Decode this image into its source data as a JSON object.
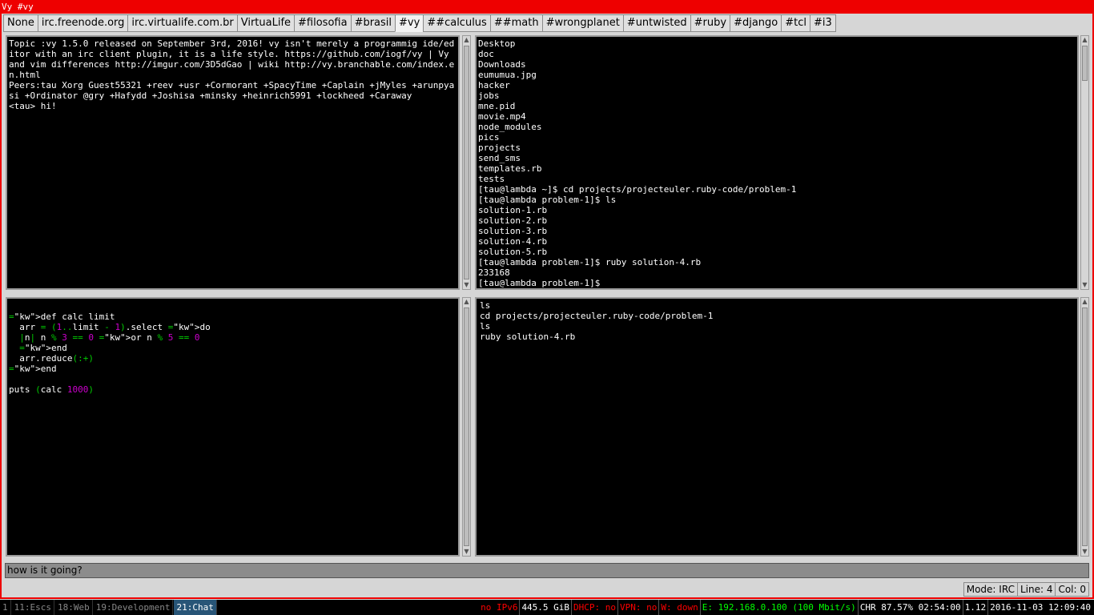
{
  "window": {
    "title": "Vy #vy"
  },
  "tabs": [
    "None",
    "irc.freenode.org",
    "irc.virtualife.com.br",
    "VirtuaLife",
    "#filosofia",
    "#brasil",
    "#vy",
    "##calculus",
    "##math",
    "#wrongplanet",
    "#untwisted",
    "#ruby",
    "#django",
    "#tcl",
    "#i3"
  ],
  "active_tab": "#vy",
  "chat_pane": {
    "text": "Topic :vy 1.5.0 released on September 3rd, 2016! vy isn't merely a programmig ide/editor with an irc client plugin, it is a life style. https://github.com/iogf/vy | Vy and vim differences http://imgur.com/3D5dGao | wiki http://vy.branchable.com/index.en.html\nPeers:tau Xorg Guest55321 +reev +usr +Cormorant +SpacyTime +Caplain +jMyles +arunpyasi +Ordinator @gry +Hafydd +Joshisa +minsky +heinrich5991 +lockheed +Caraway\n<tau> hi!"
  },
  "terminal_pane": {
    "lines": [
      "Desktop",
      "doc",
      "Downloads",
      "eumumua.jpg",
      "hacker",
      "jobs",
      "mne.pid",
      "movie.mp4",
      "node_modules",
      "pics",
      "projects",
      "send_sms",
      "templates.rb",
      "tests",
      "[tau@lambda ~]$ cd projects/projecteuler.ruby-code/problem-1",
      "[tau@lambda problem-1]$ ls",
      "solution-1.rb",
      "solution-2.rb",
      "solution-3.rb",
      "solution-4.rb",
      "solution-5.rb",
      "[tau@lambda problem-1]$ ruby solution-4.rb",
      "233168",
      "[tau@lambda problem-1]$"
    ]
  },
  "code_pane": {
    "lines": [
      "def calc limit",
      "  arr = (1..limit - 1).select do",
      "  |n| n % 3 == 0 or n % 5 == 0",
      "  end",
      "  arr.reduce(:+)",
      "end",
      "",
      "puts (calc 1000)"
    ]
  },
  "history_pane": {
    "lines": [
      "ls",
      "cd projects/projecteuler.ruby-code/problem-1",
      "ls",
      "ruby solution-4.rb"
    ]
  },
  "input": {
    "value": "how is it going?"
  },
  "status": {
    "mode": "Mode: IRC",
    "line": "Line: 4",
    "col": "Col: 0"
  },
  "i3bar": {
    "workspaces": [
      {
        "label": "1",
        "focused": false
      },
      {
        "label": "11:Escs",
        "focused": false
      },
      {
        "label": "18:Web",
        "focused": false
      },
      {
        "label": "19:Development",
        "focused": false
      },
      {
        "label": "21:Chat",
        "focused": true
      }
    ],
    "ipv6": "no IPv6",
    "disk": "445.5 GiB",
    "dhcp": "DHCP: no",
    "vpn": "VPN: no",
    "wifi": "W: down",
    "eth": "E: 192.168.0.100 (100 Mbit/s)",
    "battery": "CHR 87.57% 02:54:00",
    "load": "1.12",
    "datetime": "2016-11-03 12:09:40"
  },
  "colors": {
    "titlebar": "#ee0000",
    "focused_workspace": "#285577",
    "keyword": "#00cd00",
    "number": "#cd00cd"
  }
}
